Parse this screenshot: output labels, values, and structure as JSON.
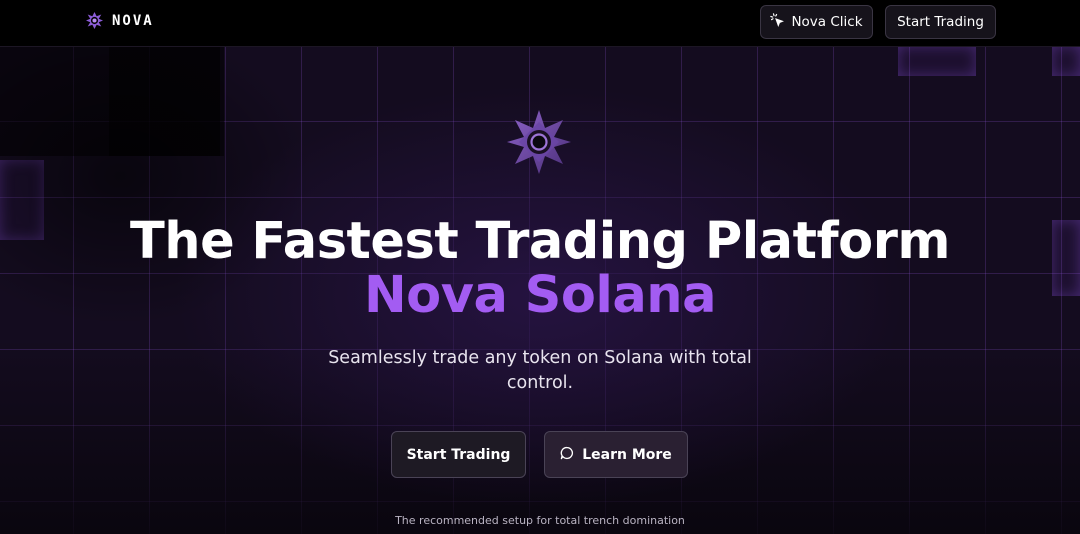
{
  "header": {
    "brand": "NOVA",
    "nav_click_label": "Nova Click",
    "nav_start_label": "Start Trading"
  },
  "hero": {
    "title": "The Fastest Trading Platform",
    "subtitle": "Nova Solana",
    "tagline": "Seamlessly trade any token on Solana with total control.",
    "primary_cta": "Start Trading",
    "secondary_cta": "Learn More",
    "footnote": "The recommended setup for total trench domination"
  },
  "colors": {
    "accent": "#a35cf2",
    "background": "#0b0810",
    "header": "#000000"
  },
  "icons": {
    "brand": "nova-star-icon",
    "nav_click": "cursor-click-icon",
    "learn_more": "chat-bubble-icon",
    "hero": "nova-star-logo"
  }
}
